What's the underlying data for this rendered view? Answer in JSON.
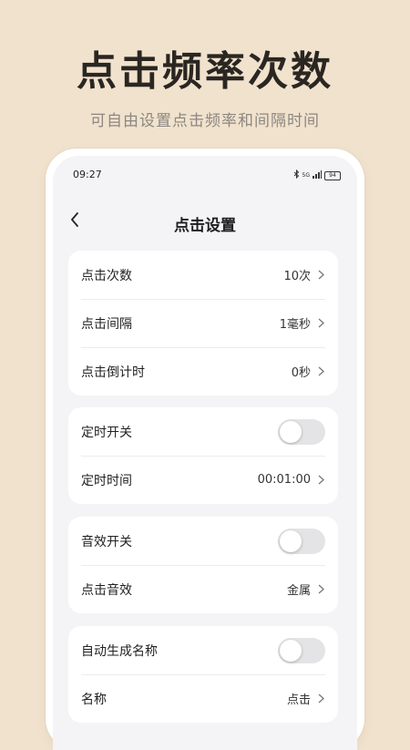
{
  "promo": {
    "headline": "点击频率次数",
    "subline": "可自由设置点击频率和间隔时间"
  },
  "status_bar": {
    "time": "09:27",
    "network_label": "5G",
    "battery_label": "94"
  },
  "nav": {
    "title": "点击设置"
  },
  "groups": [
    {
      "rows": [
        {
          "label": "点击次数",
          "value": "10次"
        },
        {
          "label": "点击间隔",
          "value": "1毫秒"
        },
        {
          "label": "点击倒计时",
          "value": "0秒"
        }
      ]
    },
    {
      "rows": [
        {
          "label": "定时开关",
          "toggle": false
        },
        {
          "label": "定时时间",
          "value": "00:01:00"
        }
      ]
    },
    {
      "rows": [
        {
          "label": "音效开关",
          "toggle": false
        },
        {
          "label": "点击音效",
          "value": "金属"
        }
      ]
    },
    {
      "rows": [
        {
          "label": "自动生成名称",
          "toggle": false
        },
        {
          "label": "名称",
          "value": "点击"
        }
      ]
    }
  ],
  "colors": {
    "background": "#f1e2cd",
    "card": "#ffffff",
    "screen": "#f4f4f6",
    "toggle_off": "#e4e4e6"
  }
}
